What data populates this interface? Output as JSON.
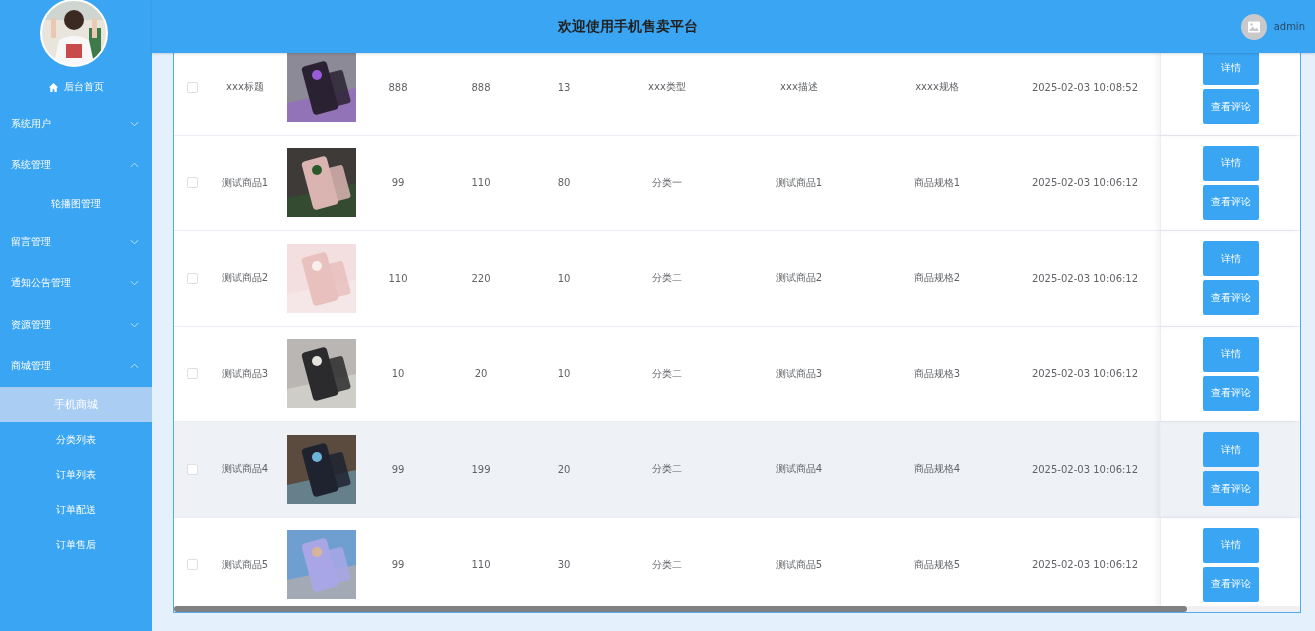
{
  "sidebar": {
    "home": "后台首页",
    "menus": [
      {
        "label": "系统用户",
        "expanded": false
      },
      {
        "label": "系统管理",
        "expanded": true,
        "children": [
          {
            "label": "轮播图管理",
            "selected": false
          }
        ]
      },
      {
        "label": "留言管理",
        "expanded": false
      },
      {
        "label": "通知公告管理",
        "expanded": false
      },
      {
        "label": "资源管理",
        "expanded": false
      },
      {
        "label": "商城管理",
        "expanded": true,
        "children": [
          {
            "label": "手机商城",
            "selected": true
          },
          {
            "label": "分类列表",
            "selected": false
          },
          {
            "label": "订单列表",
            "selected": false
          },
          {
            "label": "订单配送",
            "selected": false
          },
          {
            "label": "订单售后",
            "selected": false
          }
        ]
      }
    ]
  },
  "header": {
    "title": "欢迎使用手机售卖平台",
    "user": "admin"
  },
  "table": {
    "rows": [
      {
        "checked": false,
        "highlighted": false,
        "title": "xxx标题",
        "cells": [
          "888",
          "888",
          "13",
          "xxx类型",
          "xxx描述",
          "xxxx规格",
          "2025-02-03 10:08:52"
        ],
        "buttons": [
          "详情",
          "查看评论"
        ]
      },
      {
        "checked": false,
        "highlighted": false,
        "title": "测试商品1",
        "cells": [
          "99",
          "110",
          "80",
          "分类一",
          "测试商品1",
          "商品规格1",
          "2025-02-03 10:06:12"
        ],
        "buttons": [
          "详情",
          "查看评论"
        ]
      },
      {
        "checked": false,
        "highlighted": false,
        "title": "测试商品2",
        "cells": [
          "110",
          "220",
          "10",
          "分类二",
          "测试商品2",
          "商品规格2",
          "2025-02-03 10:06:12"
        ],
        "buttons": [
          "详情",
          "查看评论"
        ]
      },
      {
        "checked": false,
        "highlighted": false,
        "title": "测试商品3",
        "cells": [
          "10",
          "20",
          "10",
          "分类二",
          "测试商品3",
          "商品规格3",
          "2025-02-03 10:06:12"
        ],
        "buttons": [
          "详情",
          "查看评论"
        ]
      },
      {
        "checked": false,
        "highlighted": true,
        "title": "测试商品4",
        "cells": [
          "99",
          "199",
          "20",
          "分类二",
          "测试商品4",
          "商品规格4",
          "2025-02-03 10:06:12"
        ],
        "buttons": [
          "详情",
          "查看评论"
        ]
      },
      {
        "checked": false,
        "highlighted": false,
        "title": "测试商品5",
        "cells": [
          "99",
          "110",
          "30",
          "分类二",
          "测试商品5",
          "商品规格5",
          "2025-02-03 10:06:12"
        ],
        "buttons": [
          "详情",
          "查看评论"
        ]
      }
    ]
  }
}
